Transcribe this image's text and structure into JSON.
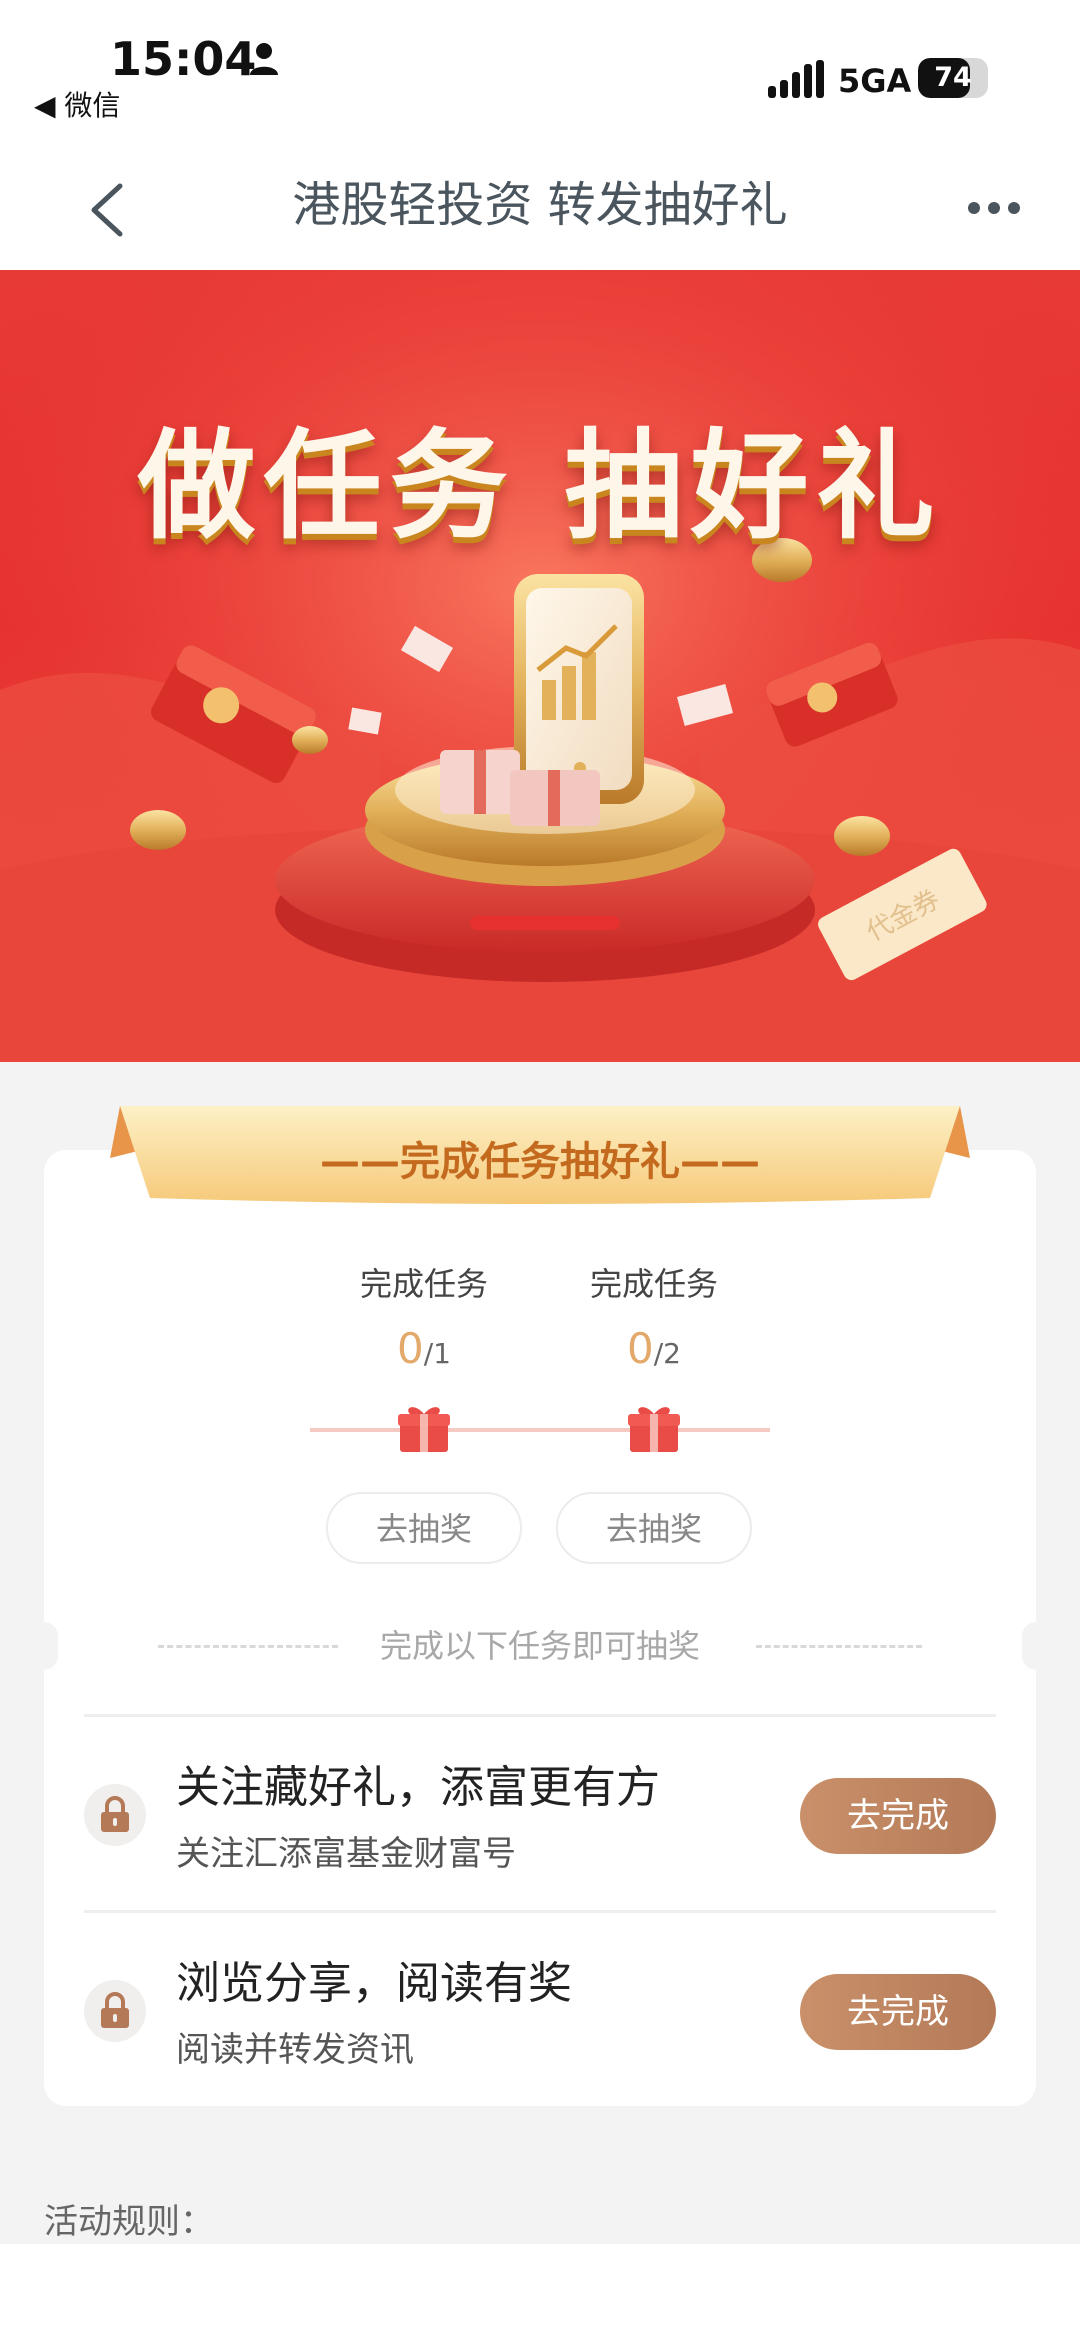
{
  "status_bar": {
    "time": "15:04",
    "back_app": "◀ 微信",
    "network": "5GA",
    "battery": "74",
    "battery_level": 0.74
  },
  "nav": {
    "title": "港股轻投资 转发抽好礼"
  },
  "hero": {
    "title": "做任务 抽好礼",
    "coupon_text": "代金券",
    "colors": {
      "primary": "#e6312f",
      "gold": "#e2b15a"
    }
  },
  "card": {
    "ribbon_title": "——完成任务抽好礼——",
    "milestones": [
      {
        "label": "完成任务",
        "done": "0",
        "total": "/1",
        "button": "去抽奖"
      },
      {
        "label": "完成任务",
        "done": "0",
        "total": "/2",
        "button": "去抽奖"
      }
    ],
    "divider_text": "完成以下任务即可抽奖",
    "tasks": [
      {
        "title": "关注藏好礼，添富更有方",
        "desc": "关注汇添富基金财富号",
        "button": "去完成",
        "icon": "lock-icon"
      },
      {
        "title": "浏览分享，阅读有奖",
        "desc": "阅读并转发资讯",
        "button": "去完成",
        "icon": "lock-icon"
      }
    ]
  },
  "footer": {
    "rules_label": "活动规则："
  }
}
